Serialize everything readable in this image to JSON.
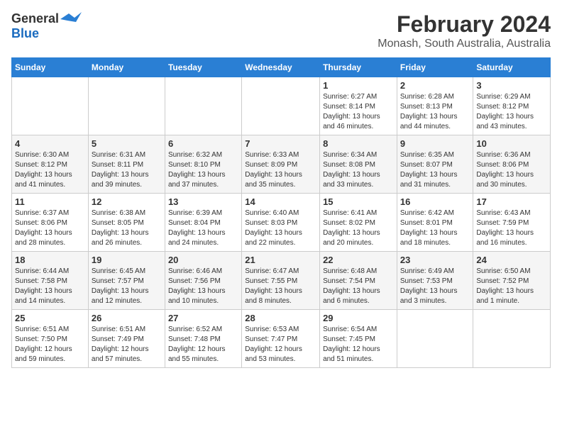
{
  "header": {
    "logo_general": "General",
    "logo_blue": "Blue",
    "month_title": "February 2024",
    "location": "Monash, South Australia, Australia"
  },
  "days_of_week": [
    "Sunday",
    "Monday",
    "Tuesday",
    "Wednesday",
    "Thursday",
    "Friday",
    "Saturday"
  ],
  "weeks": [
    {
      "days": [
        {
          "number": "",
          "info": ""
        },
        {
          "number": "",
          "info": ""
        },
        {
          "number": "",
          "info": ""
        },
        {
          "number": "",
          "info": ""
        },
        {
          "number": "1",
          "info": "Sunrise: 6:27 AM\nSunset: 8:14 PM\nDaylight: 13 hours\nand 46 minutes."
        },
        {
          "number": "2",
          "info": "Sunrise: 6:28 AM\nSunset: 8:13 PM\nDaylight: 13 hours\nand 44 minutes."
        },
        {
          "number": "3",
          "info": "Sunrise: 6:29 AM\nSunset: 8:12 PM\nDaylight: 13 hours\nand 43 minutes."
        }
      ]
    },
    {
      "days": [
        {
          "number": "4",
          "info": "Sunrise: 6:30 AM\nSunset: 8:12 PM\nDaylight: 13 hours\nand 41 minutes."
        },
        {
          "number": "5",
          "info": "Sunrise: 6:31 AM\nSunset: 8:11 PM\nDaylight: 13 hours\nand 39 minutes."
        },
        {
          "number": "6",
          "info": "Sunrise: 6:32 AM\nSunset: 8:10 PM\nDaylight: 13 hours\nand 37 minutes."
        },
        {
          "number": "7",
          "info": "Sunrise: 6:33 AM\nSunset: 8:09 PM\nDaylight: 13 hours\nand 35 minutes."
        },
        {
          "number": "8",
          "info": "Sunrise: 6:34 AM\nSunset: 8:08 PM\nDaylight: 13 hours\nand 33 minutes."
        },
        {
          "number": "9",
          "info": "Sunrise: 6:35 AM\nSunset: 8:07 PM\nDaylight: 13 hours\nand 31 minutes."
        },
        {
          "number": "10",
          "info": "Sunrise: 6:36 AM\nSunset: 8:06 PM\nDaylight: 13 hours\nand 30 minutes."
        }
      ]
    },
    {
      "days": [
        {
          "number": "11",
          "info": "Sunrise: 6:37 AM\nSunset: 8:06 PM\nDaylight: 13 hours\nand 28 minutes."
        },
        {
          "number": "12",
          "info": "Sunrise: 6:38 AM\nSunset: 8:05 PM\nDaylight: 13 hours\nand 26 minutes."
        },
        {
          "number": "13",
          "info": "Sunrise: 6:39 AM\nSunset: 8:04 PM\nDaylight: 13 hours\nand 24 minutes."
        },
        {
          "number": "14",
          "info": "Sunrise: 6:40 AM\nSunset: 8:03 PM\nDaylight: 13 hours\nand 22 minutes."
        },
        {
          "number": "15",
          "info": "Sunrise: 6:41 AM\nSunset: 8:02 PM\nDaylight: 13 hours\nand 20 minutes."
        },
        {
          "number": "16",
          "info": "Sunrise: 6:42 AM\nSunset: 8:01 PM\nDaylight: 13 hours\nand 18 minutes."
        },
        {
          "number": "17",
          "info": "Sunrise: 6:43 AM\nSunset: 7:59 PM\nDaylight: 13 hours\nand 16 minutes."
        }
      ]
    },
    {
      "days": [
        {
          "number": "18",
          "info": "Sunrise: 6:44 AM\nSunset: 7:58 PM\nDaylight: 13 hours\nand 14 minutes."
        },
        {
          "number": "19",
          "info": "Sunrise: 6:45 AM\nSunset: 7:57 PM\nDaylight: 13 hours\nand 12 minutes."
        },
        {
          "number": "20",
          "info": "Sunrise: 6:46 AM\nSunset: 7:56 PM\nDaylight: 13 hours\nand 10 minutes."
        },
        {
          "number": "21",
          "info": "Sunrise: 6:47 AM\nSunset: 7:55 PM\nDaylight: 13 hours\nand 8 minutes."
        },
        {
          "number": "22",
          "info": "Sunrise: 6:48 AM\nSunset: 7:54 PM\nDaylight: 13 hours\nand 6 minutes."
        },
        {
          "number": "23",
          "info": "Sunrise: 6:49 AM\nSunset: 7:53 PM\nDaylight: 13 hours\nand 3 minutes."
        },
        {
          "number": "24",
          "info": "Sunrise: 6:50 AM\nSunset: 7:52 PM\nDaylight: 13 hours\nand 1 minute."
        }
      ]
    },
    {
      "days": [
        {
          "number": "25",
          "info": "Sunrise: 6:51 AM\nSunset: 7:50 PM\nDaylight: 12 hours\nand 59 minutes."
        },
        {
          "number": "26",
          "info": "Sunrise: 6:51 AM\nSunset: 7:49 PM\nDaylight: 12 hours\nand 57 minutes."
        },
        {
          "number": "27",
          "info": "Sunrise: 6:52 AM\nSunset: 7:48 PM\nDaylight: 12 hours\nand 55 minutes."
        },
        {
          "number": "28",
          "info": "Sunrise: 6:53 AM\nSunset: 7:47 PM\nDaylight: 12 hours\nand 53 minutes."
        },
        {
          "number": "29",
          "info": "Sunrise: 6:54 AM\nSunset: 7:45 PM\nDaylight: 12 hours\nand 51 minutes."
        },
        {
          "number": "",
          "info": ""
        },
        {
          "number": "",
          "info": ""
        }
      ]
    }
  ]
}
